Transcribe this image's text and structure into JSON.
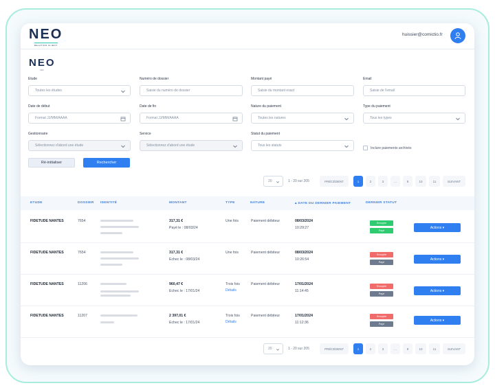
{
  "header": {
    "logo_text": "NEO",
    "logo_subtext": "RELATION CLIENT",
    "user_email": "huissier@comictio.fr"
  },
  "brand": {
    "logo_text": "NEO",
    "logo_subtext": "PAY"
  },
  "filters": {
    "etude": {
      "label": "Etude",
      "value": "Toutes les études"
    },
    "numero_dossier": {
      "label": "Numéro de dossier",
      "placeholder": "Saisie du numéro de dossier"
    },
    "montant_paye": {
      "label": "Montant payé",
      "placeholder": "Saisie du montant exact"
    },
    "email": {
      "label": "Email",
      "placeholder": "Saisie de l'email"
    },
    "date_debut": {
      "label": "Date de début",
      "placeholder": "Format JJ/MM/AAAA"
    },
    "date_fin": {
      "label": "Date de fin",
      "placeholder": "Format JJ/MM/AAAA"
    },
    "nature_paiement": {
      "label": "Nature du paiement",
      "value": "Toutes les natures"
    },
    "type_paiement": {
      "label": "Type du paiement",
      "value": "Tous les types"
    },
    "gestionnaire": {
      "label": "Gestionnaire",
      "value": "Sélectionnez d'abord une étude"
    },
    "service": {
      "label": "Service",
      "value": "Sélectionnez d'abord une étude"
    },
    "statut_paiement": {
      "label": "Statut du paiement",
      "value": "Tous les statuts"
    },
    "include_archived": {
      "label": "Inclure paiements archivés",
      "checked": false
    },
    "reset_label": "Ré-initialiser",
    "search_label": "Rechercher"
  },
  "pagination": {
    "per_page": "20",
    "range": "1 - 20 sur 205",
    "prev_label": "PRÉCÉDENT",
    "next_label": "SUIVANT",
    "pages": [
      "1",
      "2",
      "3",
      "...",
      "9",
      "10",
      "11"
    ],
    "active_page": "1"
  },
  "table": {
    "columns": [
      "ETUDE",
      "DOSSIER",
      "IDENTITÉ",
      "MONTANT",
      "TYPE",
      "NATURE",
      "DATE DU DERNIER PAIEMENT",
      "DERNIER STATUT"
    ],
    "rows": [
      {
        "etude": "FIDETUDE NANTES",
        "dossier": "7654",
        "montant": "317,31 €",
        "montant_detail": "Payé le : 08/03/24",
        "type": "Une fois",
        "type_link": "",
        "nature": "Paiement débiteur",
        "date": "08/03/2024",
        "time": "10:29:27",
        "status1": "Envoyée",
        "status1_color": "green",
        "status2": "Payé",
        "status2_color": "green"
      },
      {
        "etude": "FIDETUDE NANTES",
        "dossier": "7654",
        "montant": "317,31 €",
        "montant_detail": "Echec le : 08/03/24",
        "type": "Une fois",
        "type_link": "",
        "nature": "Paiement débiteur",
        "date": "08/03/2024",
        "time": "10:26:54",
        "status1": "Envoyée",
        "status1_color": "red",
        "status2": "Payé",
        "status2_color": "grey"
      },
      {
        "etude": "FIDETUDE NANTES",
        "dossier": "11206",
        "montant": "960,47 €",
        "montant_detail": "Echec le : 17/01/24",
        "type": "Trois fois",
        "type_link": "Détails",
        "nature": "Paiement débiteur",
        "date": "17/01/2024",
        "time": "11:14:45",
        "status1": "Envoyée",
        "status1_color": "red",
        "status2": "Payé",
        "status2_color": "grey"
      },
      {
        "etude": "FIDETUDE NANTES",
        "dossier": "11207",
        "montant": "2 397,01 €",
        "montant_detail": "Echec le : 17/01/24",
        "type": "Trois fois",
        "type_link": "Détails",
        "nature": "Paiement débiteur",
        "date": "17/01/2024",
        "time": "11:12:36",
        "status1": "Envoyée",
        "status1_color": "red",
        "status2": "Payé",
        "status2_color": "grey"
      }
    ],
    "actions_label": "Actions"
  }
}
